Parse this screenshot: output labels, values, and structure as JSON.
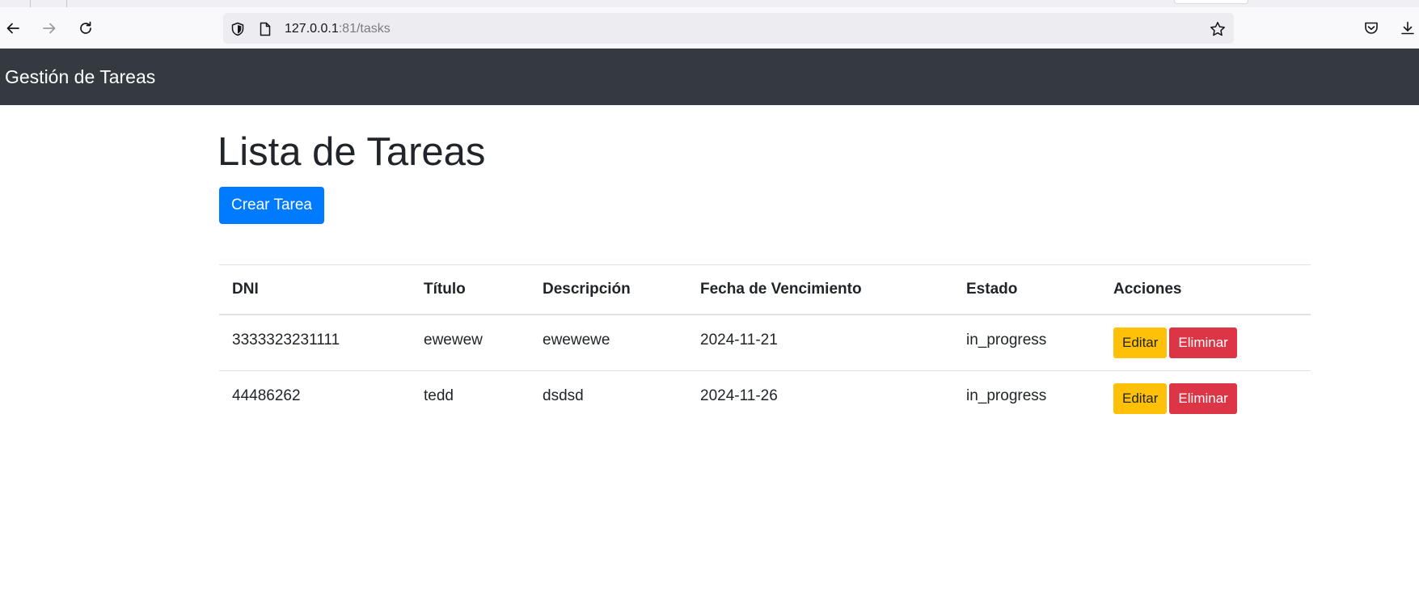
{
  "browser": {
    "url_host": "127.0.0.1",
    "url_rest": ":81/tasks",
    "icons": [
      "back-arrow-icon",
      "forward-arrow-icon",
      "reload-icon",
      "shield-icon",
      "page-icon",
      "bookmark-star-icon",
      "pocket-icon",
      "download-icon"
    ]
  },
  "navbar": {
    "brand": "Gestión de Tareas"
  },
  "page": {
    "title": "Lista de Tareas",
    "create_button": "Crear Tarea"
  },
  "table": {
    "headers": [
      "DNI",
      "Título",
      "Descripción",
      "Fecha de Vencimiento",
      "Estado",
      "Acciones"
    ],
    "rows": [
      {
        "dni": "3333323231111",
        "titulo": "ewewew",
        "descripcion": "ewewewe",
        "fecha": "2024-11-21",
        "estado": "in_progress"
      },
      {
        "dni": "44486262",
        "titulo": "tedd",
        "descripcion": "dsdsd",
        "fecha": "2024-11-26",
        "estado": "in_progress"
      }
    ],
    "edit_label": "Editar",
    "delete_label": "Eliminar"
  },
  "colors": {
    "navbar_bg": "#343a40",
    "primary": "#007bff",
    "warning": "#ffc107",
    "danger": "#dc3545"
  }
}
